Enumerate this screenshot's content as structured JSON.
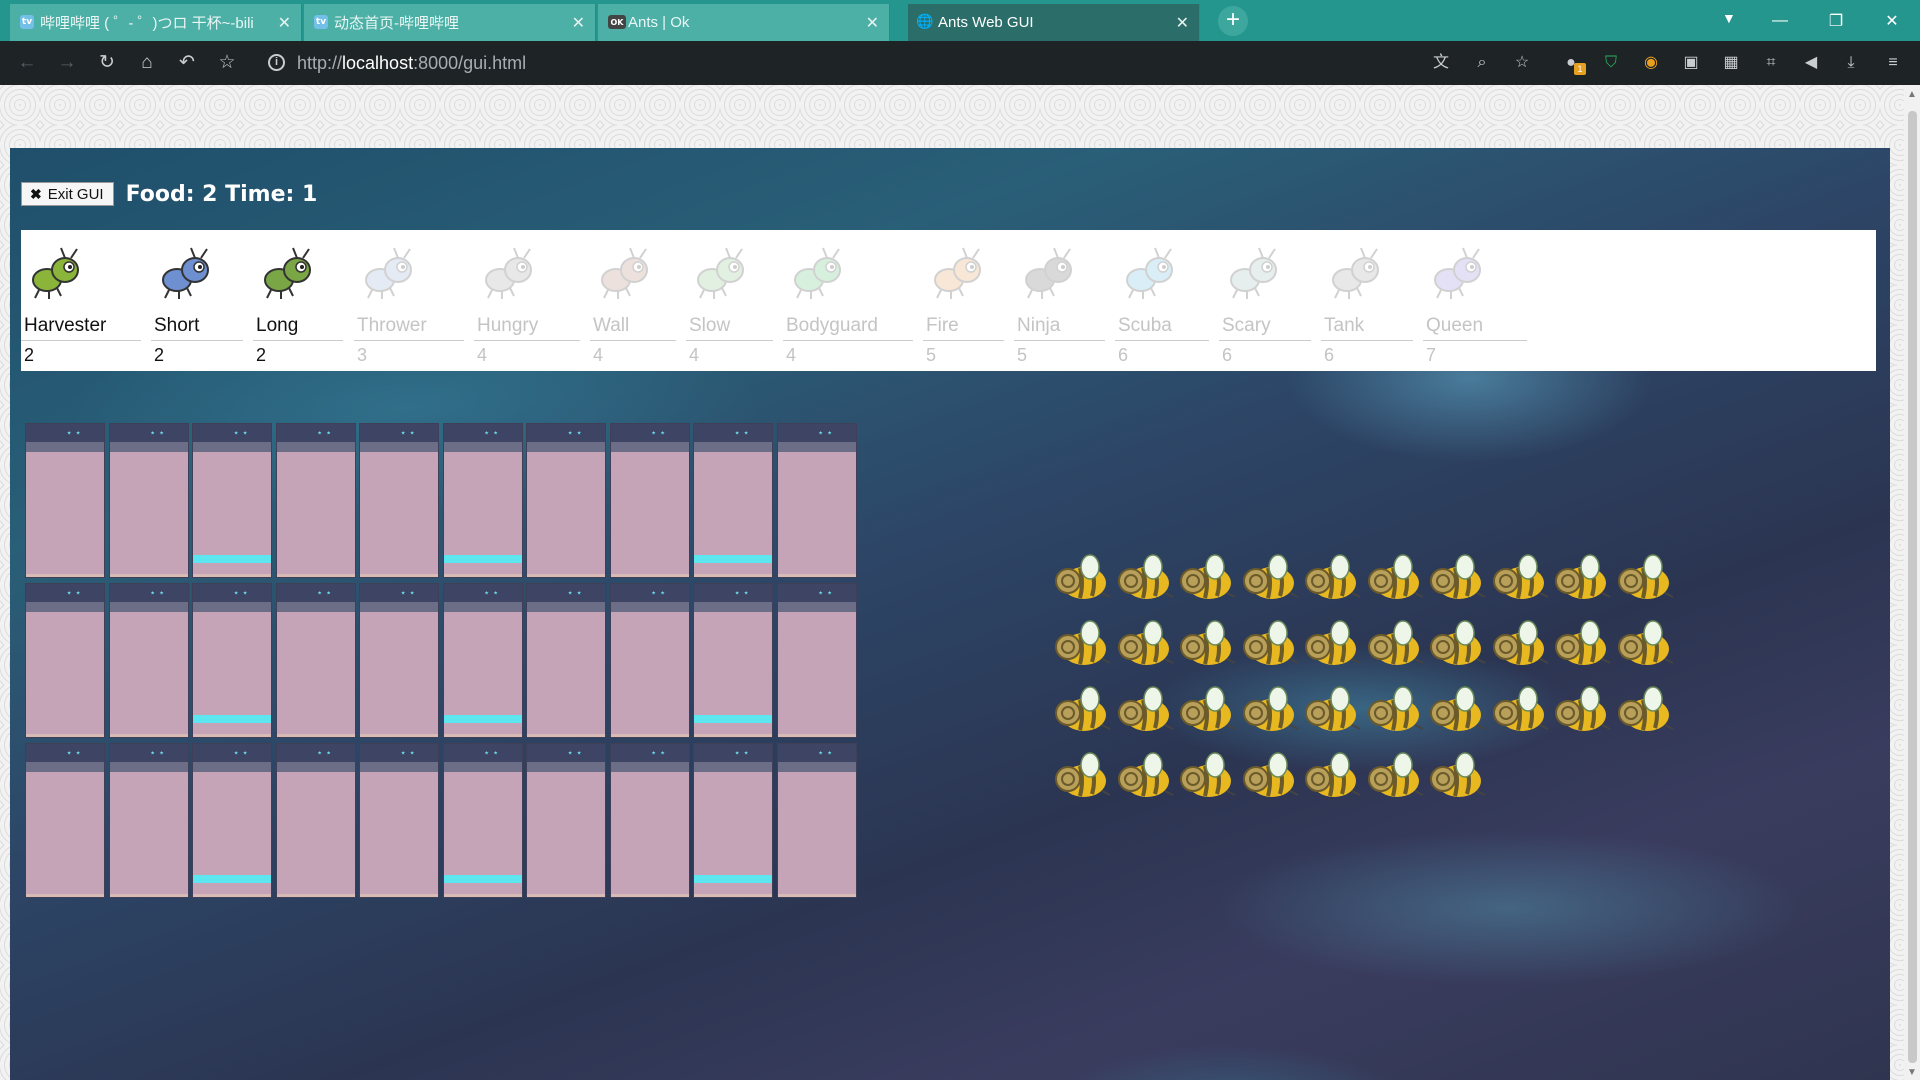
{
  "browser": {
    "tabs": [
      {
        "title": "哔哩哔哩 ( ゜- ゜)つロ 干杯~-bili",
        "favicon": "bilibili-icon",
        "active": false
      },
      {
        "title": "动态首页-哔哩哔哩",
        "favicon": "bilibili-icon",
        "active": false
      },
      {
        "title": "Ants | Ok",
        "favicon": "ok-icon",
        "active": false
      },
      {
        "title": "Ants Web GUI",
        "favicon": "globe-icon",
        "active": true
      }
    ],
    "url_prefix": "http://",
    "url_host": "localhost",
    "url_rest": ":8000/gui.html",
    "extension_badge": "1"
  },
  "game": {
    "exit_label": "Exit GUI",
    "status": "Food: 2 Time: 1",
    "ants": [
      {
        "name": "Harvester",
        "cost": "2",
        "available": true,
        "color": "#8ab53a"
      },
      {
        "name": "Short",
        "cost": "2",
        "available": true,
        "color": "#6e8fd0"
      },
      {
        "name": "Long",
        "cost": "2",
        "available": true,
        "color": "#7aa645"
      },
      {
        "name": "Thrower",
        "cost": "3",
        "available": false,
        "color": "#8ea6d0"
      },
      {
        "name": "Hungry",
        "cost": "4",
        "available": false,
        "color": "#9a9a9a"
      },
      {
        "name": "Wall",
        "cost": "4",
        "available": false,
        "color": "#b07a6a"
      },
      {
        "name": "Slow",
        "cost": "4",
        "available": false,
        "color": "#7abf7a"
      },
      {
        "name": "Bodyguard",
        "cost": "4",
        "available": false,
        "color": "#4cbf6a"
      },
      {
        "name": "Fire",
        "cost": "5",
        "available": false,
        "color": "#e0954a"
      },
      {
        "name": "Ninja",
        "cost": "5",
        "available": false,
        "color": "#555555"
      },
      {
        "name": "Scuba",
        "cost": "6",
        "available": false,
        "color": "#5ab3e0"
      },
      {
        "name": "Scary",
        "cost": "6",
        "available": false,
        "color": "#8fb8b0"
      },
      {
        "name": "Tank",
        "cost": "6",
        "available": false,
        "color": "#9a9a9a"
      },
      {
        "name": "Queen",
        "cost": "7",
        "available": false,
        "color": "#8a7ad8"
      }
    ],
    "tunnel_rows": 3,
    "tunnel_cols": 10,
    "water_columns": [
      2,
      5,
      8
    ],
    "bee_rows": [
      10,
      10,
      10,
      7
    ],
    "colors": {
      "bee_body": "#e8b820",
      "bee_stripe": "#6b5a2a",
      "water": "#5ee6f0",
      "tunnel_floor": "#c4a4b6"
    }
  }
}
